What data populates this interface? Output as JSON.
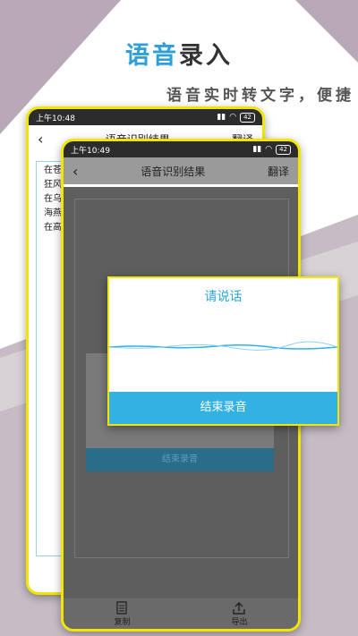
{
  "headline": {
    "part1": "语音",
    "part2": "录入"
  },
  "subline": "语音实时转文字，便捷",
  "colors": {
    "accent_blue": "#33b1e3",
    "frame_yellow": "#f2e600",
    "mic_green": "#0b6e60"
  },
  "back_phone": {
    "status_time": "上午10:48",
    "battery": "42",
    "title": "语音识别结果",
    "right_action": "翻译",
    "text_lines": [
      "在苍茫",
      "狂风卷",
      "在乌云",
      "海燕像",
      "在高傲"
    ]
  },
  "front_phone": {
    "status_time": "上午10:49",
    "battery": "42",
    "title": "语音识别结果",
    "right_action": "翻译",
    "ghost_button": "结束录音",
    "bottom": {
      "copy": "复制",
      "export": "导出"
    }
  },
  "dialog": {
    "title": "请说话",
    "button": "结束录音"
  },
  "icons": {
    "back": "chevron-left-icon",
    "mic": "microphone-icon",
    "copy": "document-icon",
    "export": "upload-icon"
  }
}
